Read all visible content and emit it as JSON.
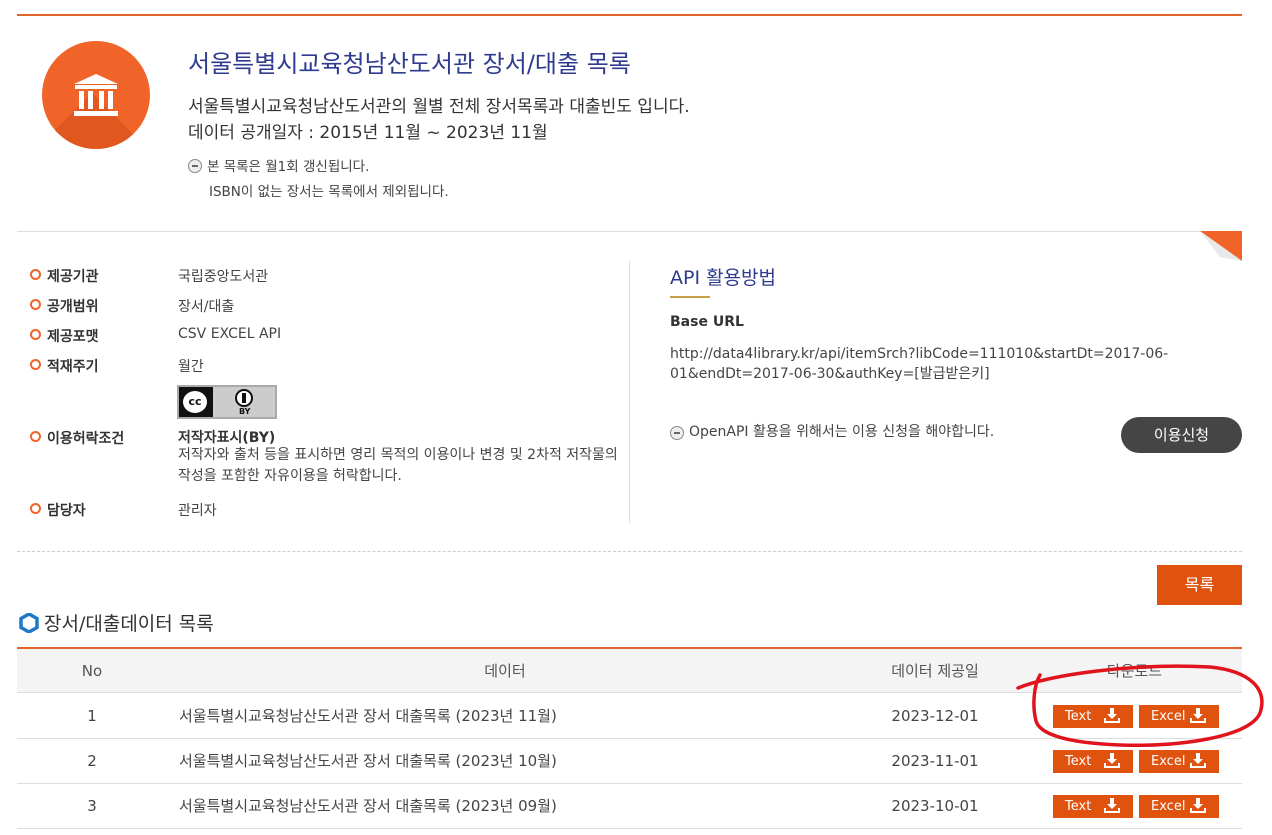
{
  "colors": {
    "accent": "#e0530f",
    "title_blue": "#2f3b8f",
    "annotation_red": "#e0141c"
  },
  "header": {
    "title": "서울특별시교육청남산도서관 장서/대출 목록",
    "description": "서울특별시교육청남산도서관의 월별 전체 장서목록과 대출빈도 입니다.",
    "period": "데이터 공개일자 : 2015년 11월 ~ 2023년 11월",
    "notes": [
      "본 목록은 월1회 갱신됩니다.",
      "ISBN이 없는 장서는 목록에서 제외됩니다."
    ],
    "logo_icon": "library-building-icon"
  },
  "meta": {
    "provider": {
      "label": "제공기관",
      "value": "국립중앙도서관"
    },
    "scope": {
      "label": "공개범위",
      "value": "장서/대출"
    },
    "formats": {
      "label": "제공포맷",
      "value": "CSV EXCEL API"
    },
    "cycle": {
      "label": "적재주기",
      "value": "월간"
    },
    "license": {
      "label": "이용허락조건",
      "badge_left": "cc",
      "badge_right": "BY",
      "title": "저작자표시(BY)",
      "text": "저작자와 출처 등을 표시하면 영리 목적의 이용이나 변경 및 2차적 저작물의 작성을 포함한 자유이용을 허락합니다."
    },
    "manager": {
      "label": "담당자",
      "value": "관리자"
    }
  },
  "api": {
    "title": "API 활용방법",
    "base_url_label": "Base URL",
    "base_url": "http://data4library.kr/api/itemSrch?libCode=111010&startDt=2017-06-01&endDt=2017-06-30&authKey=[발급받은키]",
    "note": "OpenAPI 활용을 위해서는 이용 신청을 해야합니다.",
    "apply_label": "이용신청"
  },
  "list_button": "목록",
  "section_title": "장서/대출데이터 목록",
  "table": {
    "headers": {
      "no": "No",
      "data": "데이터",
      "date": "데이터 제공일",
      "download": "다운로드"
    },
    "rows": [
      {
        "no": "1",
        "data": "서울특별시교육청남산도서관 장서 대출목록 (2023년 11월)",
        "date": "2023-12-01",
        "text_btn": "Text",
        "excel_btn": "Excel"
      },
      {
        "no": "2",
        "data": "서울특별시교육청남산도서관 장서 대출목록 (2023년 10월)",
        "date": "2023-11-01",
        "text_btn": "Text",
        "excel_btn": "Excel"
      },
      {
        "no": "3",
        "data": "서울특별시교육청남산도서관 장서 대출목록 (2023년 09월)",
        "date": "2023-10-01",
        "text_btn": "Text",
        "excel_btn": "Excel"
      }
    ]
  }
}
